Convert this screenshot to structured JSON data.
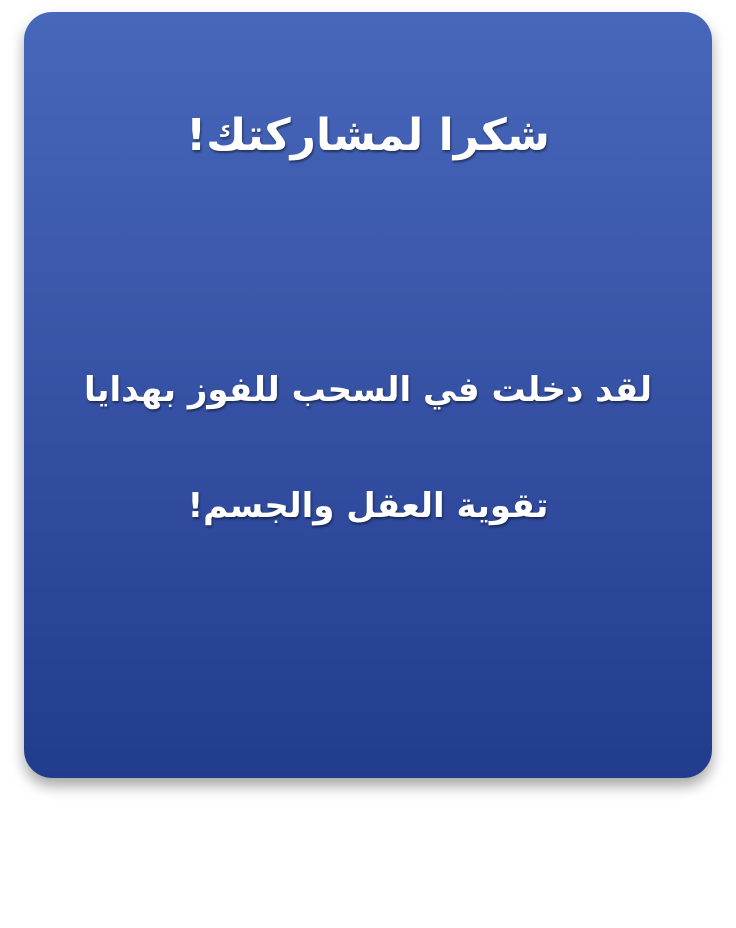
{
  "card": {
    "title": "شكرا لمشاركتك!",
    "message": "لقد دخلت في السحب للفوز بهدايا تقوية العقل والجسم!"
  },
  "colors": {
    "card_top": "#4767bb",
    "card_bottom": "#213b8d",
    "text": "#ffffff",
    "page_background": "#ffffff"
  }
}
